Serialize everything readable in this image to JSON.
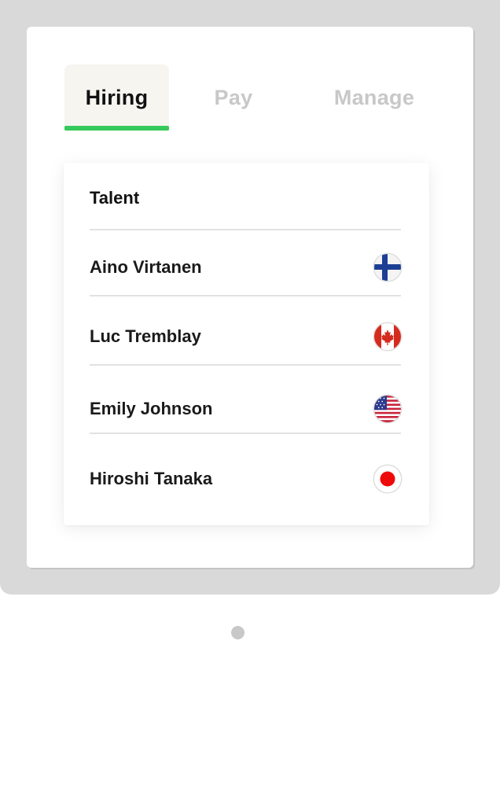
{
  "tabs": [
    {
      "label": "Hiring",
      "active": true
    },
    {
      "label": "Pay",
      "active": false
    },
    {
      "label": "Manage",
      "active": false
    }
  ],
  "accent_color": "#36c95b",
  "card": {
    "title": "Talent",
    "rows": [
      {
        "name": "Aino Virtanen",
        "flag": "finland-flag-icon"
      },
      {
        "name": "Luc Tremblay",
        "flag": "canada-flag-icon"
      },
      {
        "name": "Emily Johnson",
        "flag": "usa-flag-icon"
      },
      {
        "name": "Hiroshi Tanaka",
        "flag": "japan-flag-icon"
      }
    ]
  }
}
